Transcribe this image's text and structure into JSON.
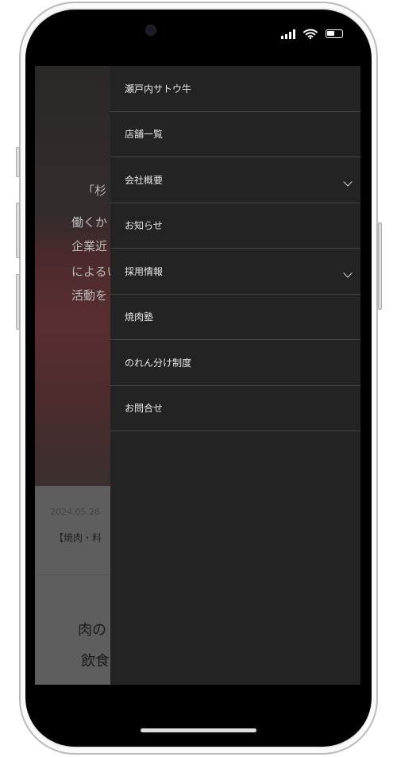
{
  "status_bar": {
    "icons": [
      "signal-icon",
      "wifi-icon",
      "battery-icon"
    ]
  },
  "background_page": {
    "hero_lines": [
      "「杉",
      "働くか",
      "企業近",
      "によるい",
      "活動を"
    ],
    "news": {
      "date": "2024.05.26",
      "title": "【焼肉・料"
    },
    "lead_lines": [
      "肉の",
      "飲食"
    ]
  },
  "menu": {
    "items": [
      {
        "label": "瀬戸内サトウ牛",
        "expandable": false
      },
      {
        "label": "店舗一覧",
        "expandable": false
      },
      {
        "label": "会社概要",
        "expandable": true
      },
      {
        "label": "お知らせ",
        "expandable": false
      },
      {
        "label": "採用情報",
        "expandable": true
      },
      {
        "label": "焼肉塾",
        "expandable": false
      },
      {
        "label": "のれん分け制度",
        "expandable": false
      },
      {
        "label": "お問合せ",
        "expandable": false
      }
    ]
  },
  "colors": {
    "menu_bg": "#232323",
    "menu_text": "#e8e8e8",
    "divider": "#444444"
  }
}
